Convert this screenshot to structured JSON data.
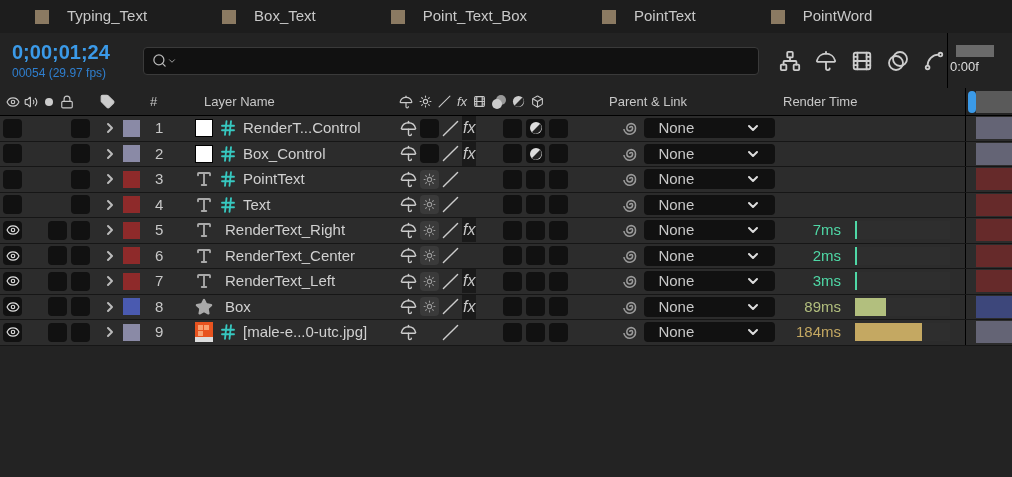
{
  "tabs": [
    {
      "label": "Typing_Text",
      "selected": false
    },
    {
      "label": "Box_Text",
      "selected": false
    },
    {
      "label": "Point_Text_Box",
      "selected": false
    },
    {
      "label": "PointText",
      "selected": false
    },
    {
      "label": "PointWord",
      "selected": false
    }
  ],
  "timecode": "0;00;01;24",
  "frame_info": "00054 (29.97 fps)",
  "timeline": {
    "time_label": "0:00f"
  },
  "columns": {
    "number": "#",
    "layer_name": "Layer Name",
    "parent": "Parent & Link",
    "render_time": "Render Time",
    "fx_symbol": "fx"
  },
  "layers": [
    {
      "number": "1",
      "name": "RenderT...Control",
      "kind": "solid",
      "color": "#8a8aa6",
      "visible": false,
      "guide": true,
      "collapse": false,
      "effects": true,
      "effects_label": "fx",
      "adjustment": true,
      "parent": "None"
    },
    {
      "number": "2",
      "name": "Box_Control",
      "kind": "solid",
      "color": "#8a8aa6",
      "visible": false,
      "guide": true,
      "collapse": false,
      "effects": true,
      "effects_label": "fx",
      "adjustment": true,
      "parent": "None"
    },
    {
      "number": "3",
      "name": "PointText",
      "kind": "text",
      "color": "#8e2a2a",
      "visible": false,
      "guide": true,
      "collapse": true,
      "effects": false,
      "adjustment": false,
      "parent": "None"
    },
    {
      "number": "4",
      "name": "Text",
      "kind": "text",
      "color": "#8e2a2a",
      "visible": false,
      "guide": true,
      "collapse": true,
      "effects": false,
      "adjustment": false,
      "parent": "None"
    },
    {
      "number": "5",
      "name": "RenderText_Right",
      "kind": "text",
      "color": "#8e2a2a",
      "visible": true,
      "guide": false,
      "collapse": true,
      "effects": true,
      "effects_label": "fx",
      "adjustment": false,
      "parent": "None",
      "render": {
        "time": "7ms",
        "level": 0.02,
        "color": "#4fd8a6"
      }
    },
    {
      "number": "6",
      "name": "RenderText_Center",
      "kind": "text",
      "color": "#8e2a2a",
      "visible": true,
      "guide": false,
      "collapse": true,
      "effects": false,
      "adjustment": false,
      "parent": "None",
      "render": {
        "time": "2ms",
        "level": 0.02,
        "color": "#4fd8a6"
      }
    },
    {
      "number": "7",
      "name": "RenderText_Left",
      "kind": "text",
      "color": "#8e2a2a",
      "visible": true,
      "guide": false,
      "collapse": true,
      "effects": true,
      "effects_label": "fx",
      "adjustment": false,
      "parent": "None",
      "render": {
        "time": "3ms",
        "level": 0.02,
        "color": "#4fd8a6"
      }
    },
    {
      "number": "8",
      "name": "Box",
      "kind": "shape",
      "color": "#4a5ab0",
      "visible": true,
      "guide": false,
      "collapse": true,
      "effects": true,
      "effects_label": "fx",
      "adjustment": false,
      "parent": "None",
      "render": {
        "time": "89ms",
        "level": 0.33,
        "color": "#b2bf7e"
      }
    },
    {
      "number": "9",
      "name": "[male-e...0-utc.jpg]",
      "kind": "footage",
      "color": "#8a8aa6",
      "visible": true,
      "guide": true,
      "collapse": false,
      "effects": false,
      "adjustment": false,
      "parent": "None",
      "render": {
        "time": "184ms",
        "level": 0.71,
        "color": "#c4a862"
      }
    }
  ]
}
